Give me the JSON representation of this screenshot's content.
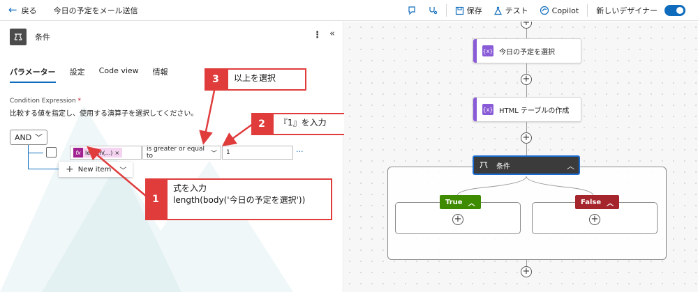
{
  "topbar": {
    "back_label": "戻る",
    "flow_title": "今日の予定をメール送信",
    "save_label": "保存",
    "test_label": "テスト",
    "copilot_label": "Copilot",
    "new_designer_label": "新しいデザイナー",
    "new_designer_on": true
  },
  "panel": {
    "title": "条件",
    "tabs": [
      {
        "label": "パラメーター",
        "active": true
      },
      {
        "label": "設定",
        "active": false
      },
      {
        "label": "Code view",
        "active": false
      },
      {
        "label": "情報",
        "active": false
      }
    ],
    "condition_label": "Condition Expression",
    "required_mark": "*",
    "condition_desc": "比較する値を指定し、使用する演算子を選択してください。",
    "group_operator": "AND",
    "row": {
      "expression_token": "length(...)",
      "token_remove": "×",
      "fx_label": "fx",
      "operator": "is greater or equal to",
      "value": "1"
    },
    "new_item_label": "New item",
    "more_glyph": "···"
  },
  "callouts": [
    {
      "num": "1",
      "lines": [
        "式を入力",
        "length(body('今日の予定を選択'))"
      ]
    },
    {
      "num": "2",
      "lines": [
        "『1』を入力"
      ]
    },
    {
      "num": "3",
      "lines": [
        "以上を選択"
      ]
    }
  ],
  "canvas": {
    "node_select": "今日の予定を選択",
    "node_html": "HTML テーブルの作成",
    "node_condition": "条件",
    "true_label": "True",
    "false_label": "False",
    "node_icon_glyph": "{x}"
  },
  "colors": {
    "accent": "#0f6cbd",
    "callout_red": "#e03c3c",
    "true_green": "#3f8b00",
    "false_red": "#a4262c",
    "action_purple": "#8a5bd6"
  }
}
